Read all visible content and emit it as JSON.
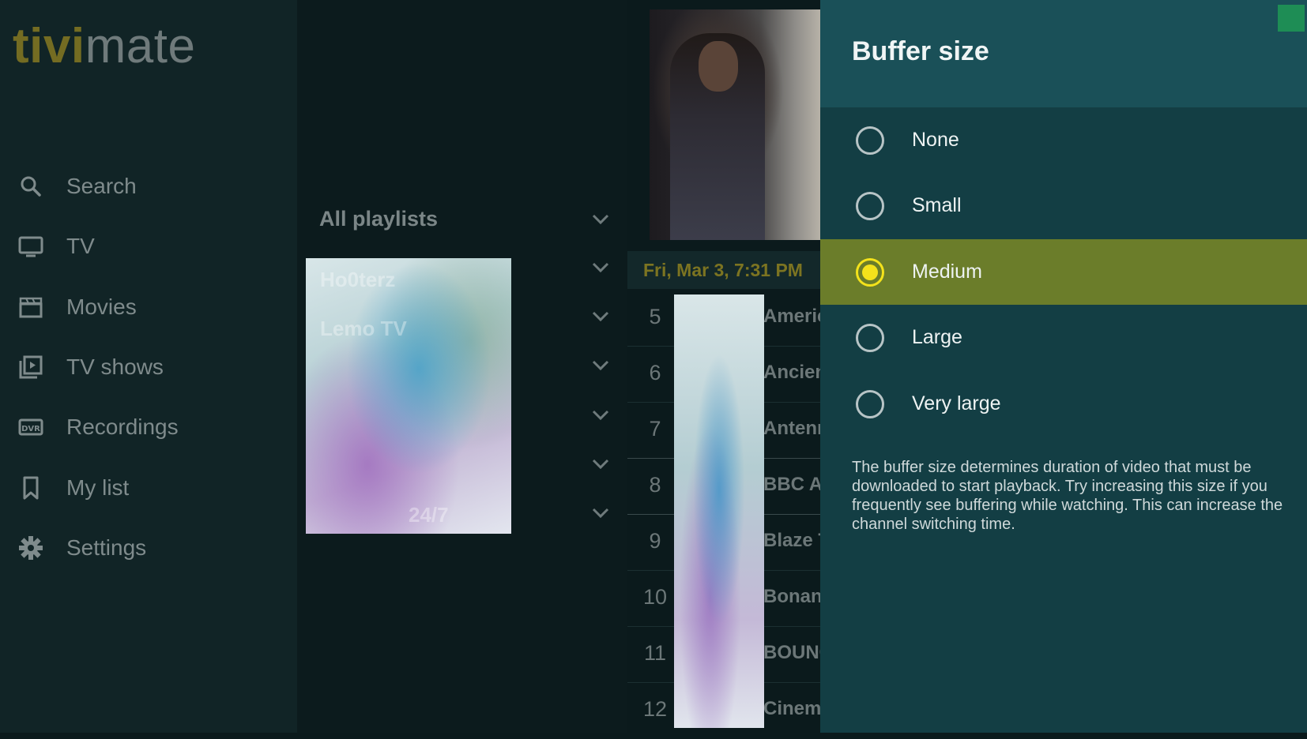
{
  "app": {
    "logo_part1": "tivi",
    "logo_part2": "mate"
  },
  "sidebar": {
    "items": [
      {
        "label": "Search",
        "icon": "search-icon"
      },
      {
        "label": "TV",
        "icon": "tv-icon"
      },
      {
        "label": "Movies",
        "icon": "clapperboard-icon"
      },
      {
        "label": "TV shows",
        "icon": "tv-shows-icon"
      },
      {
        "label": "Recordings",
        "icon": "dvr-icon"
      },
      {
        "label": "My list",
        "icon": "bookmark-icon"
      },
      {
        "label": "Settings",
        "icon": "gear-icon"
      }
    ]
  },
  "playlists": {
    "all_label": "All playlists",
    "items": [
      {
        "label": "Ho0terz"
      },
      {
        "label": "Lemo TV"
      },
      {
        "label": ""
      },
      {
        "label": ""
      },
      {
        "label": ""
      },
      {
        "label": "24/7"
      }
    ]
  },
  "guide": {
    "datetime": "Fri, Mar 3, 7:31 PM",
    "channels": [
      {
        "number": "5",
        "name": "Americ"
      },
      {
        "number": "6",
        "name": "Ancien"
      },
      {
        "number": "7",
        "name": "Antenn"
      },
      {
        "number": "8",
        "name": "BBC Ar"
      },
      {
        "number": "9",
        "name": "Blaze T"
      },
      {
        "number": "10",
        "name": "Bonan"
      },
      {
        "number": "11",
        "name": "BOUNC"
      },
      {
        "number": "12",
        "name": "Cinema"
      }
    ]
  },
  "dialog": {
    "title": "Buffer size",
    "selected": "Medium",
    "options": [
      {
        "label": "None",
        "selected": false
      },
      {
        "label": "Small",
        "selected": false
      },
      {
        "label": "Medium",
        "selected": true
      },
      {
        "label": "Large",
        "selected": false
      },
      {
        "label": "Very large",
        "selected": false
      }
    ],
    "description": "The buffer size determines duration of video that must be downloaded to start playback. Try increasing this size if you frequently see buffering while watching. This can increase the channel switching time."
  },
  "colors": {
    "accent_yellow": "#f4e21b",
    "selected_row": "#6b7d2a",
    "panel_bg": "#133e44",
    "panel_header": "#1a5058"
  }
}
